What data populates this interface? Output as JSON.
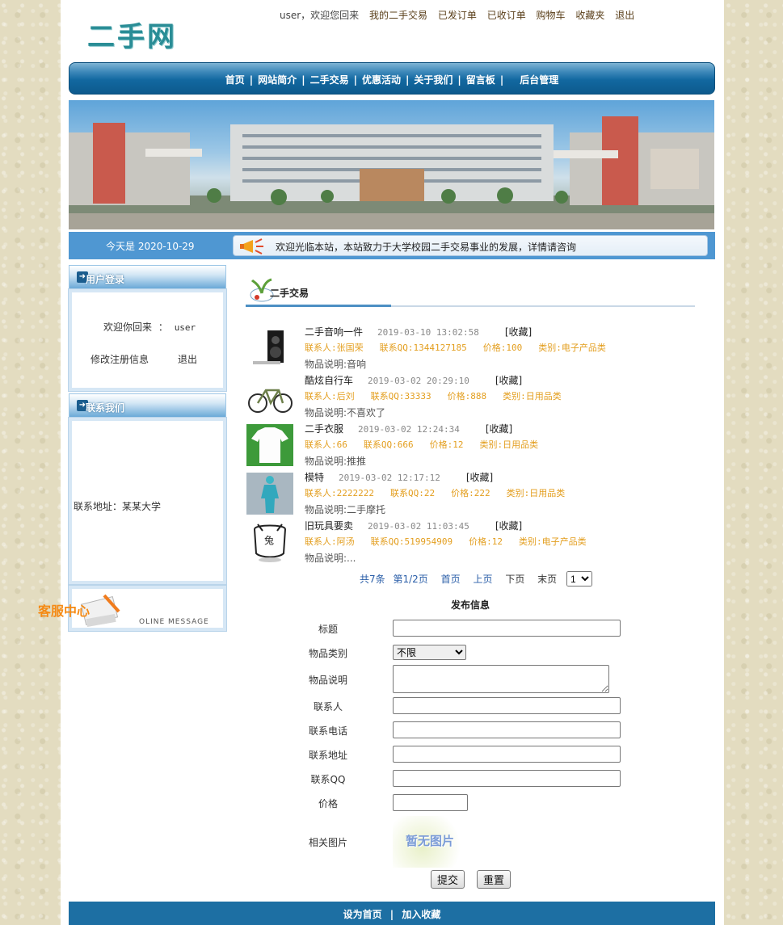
{
  "header": {
    "logo": "二手网",
    "welcome": "user，欢迎您回来",
    "links": [
      "我的二手交易",
      "已发订单",
      "已收订单",
      "购物车",
      "收藏夹",
      "退出"
    ]
  },
  "nav": {
    "items": [
      "首页",
      "网站简介",
      "二手交易",
      "优惠活动",
      "关于我们",
      "留言板",
      "后台管理"
    ],
    "separator": "|"
  },
  "infobar": {
    "date": "今天是 2020-10-29",
    "marquee": "欢迎光临本站，本站致力于大学校园二手交易事业的发展，详情请咨询"
  },
  "sidebar": {
    "login_title": "用户登录",
    "welcome_label": "欢迎你回来",
    "welcome_colon": "：",
    "username": "user",
    "edit_info": "修改注册信息",
    "logout": "退出",
    "contact_title": "联系我们",
    "address": "联系地址：某某大学",
    "oline_message": "OLINE MESSAGE",
    "service": "客服中心"
  },
  "section": {
    "title": "二手交易"
  },
  "goods": [
    {
      "name": "二手音响一件",
      "date": "2019-03-10 13:02:58",
      "fav": "[收藏]",
      "contact": "联系人:张国荣",
      "qq": "联系QQ:1344127185",
      "price": "价格:100",
      "category": "类别:电子产品类",
      "desc": "物品说明:音响"
    },
    {
      "name": "酷炫自行车",
      "date": "2019-03-02 20:29:10",
      "fav": "[收藏]",
      "contact": "联系人:后刘",
      "qq": "联系QQ:33333",
      "price": "价格:888",
      "category": "类别:日用品类",
      "desc": "物品说明:不喜欢了"
    },
    {
      "name": "二手衣服",
      "date": "2019-03-02 12:24:34",
      "fav": "[收藏]",
      "contact": "联系人:66",
      "qq": "联系QQ:666",
      "price": "价格:12",
      "category": "类别:日用品类",
      "desc": "物品说明:推推"
    },
    {
      "name": "模特",
      "date": "2019-03-02 12:17:12",
      "fav": "[收藏]",
      "contact": "联系人:2222222",
      "qq": "联系QQ:22",
      "price": "价格:222",
      "category": "类别:日用品类",
      "desc": "物品说明:二手摩托"
    },
    {
      "name": "旧玩具要卖",
      "date": "2019-03-02 11:03:45",
      "fav": "[收藏]",
      "contact": "联系人:阿汤",
      "qq": "联系QQ:519954909",
      "price": "价格:12",
      "category": "类别:电子产品类",
      "desc": "物品说明:..."
    }
  ],
  "pager": {
    "total": "共7条",
    "page": "第1/2页",
    "first": "首页",
    "prev": "上页",
    "next": "下页",
    "last": "末页",
    "selected": "1"
  },
  "form": {
    "title": "发布信息",
    "labels": {
      "title": "标题",
      "category": "物品类别",
      "desc": "物品说明",
      "contact": "联系人",
      "phone": "联系电话",
      "address": "联系地址",
      "qq": "联系QQ",
      "price": "价格",
      "image": "相关图片"
    },
    "category_selected": "不限",
    "no_image": "暂无图片",
    "submit": "提交",
    "reset": "重置"
  },
  "footer": {
    "home": "设为首页",
    "sep": "|",
    "favorite": "加入收藏"
  }
}
